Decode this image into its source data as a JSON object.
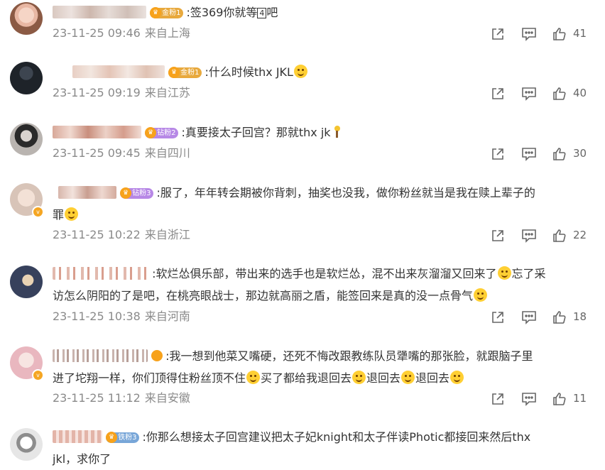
{
  "comments": [
    {
      "username": "Tichelapastles",
      "fan_badge": "金粉1",
      "text": ":签369你就等",
      "boxed": "4",
      "tail": "吧",
      "time": "23-11-25 09:46",
      "location": "来自上海",
      "likes": "41"
    },
    {
      "username": "定会有好事发生",
      "fan_badge": "金粉1",
      "text": ":什么时候thx JKL",
      "time": "23-11-25 09:19",
      "location": "来自江苏",
      "likes": "40"
    },
    {
      "username": "有人都不知成子",
      "fan_badge": "钻粉2",
      "text": ":真要接太子回宫？那就thx jk",
      "time": "23-11-25 09:45",
      "location": "来自四川",
      "likes": "30"
    },
    {
      "username": "于阿林好",
      "fan_badge": "钻粉3",
      "text_line1": ":服了，年年转会期被你背刺，抽奖也没我，做你粉丝就当是我在赎上辈子的",
      "text_line2": "罪",
      "time": "23-11-25 10:22",
      "location": "来自浙江",
      "likes": "22"
    },
    {
      "username": "",
      "text_line1": ":软烂怂俱乐部，带出来的选手也是软烂怂，混不出来灰溜溜又回来了",
      "text_line1b": "忘了采",
      "text_line2": "访怎么阴阳的了是吧，在桃亮眼战士，那边就高丽之盾，能签回来是真的没一点骨气",
      "time": "23-11-25 10:38",
      "location": "来自河南",
      "likes": "18"
    },
    {
      "username": "",
      "text_line1": ":我一想到他菜又嘴硬，还死不悔改跟教练队员犟嘴的那张脸，就跟脑子里",
      "text_line2a": "进了坨翔一样，你们顶得住粉丝顶不住",
      "text_line2b": "买了都给我退回去",
      "text_line2c": "退回去",
      "text_line2d": "退回去",
      "time": "23-11-25 11:12",
      "location": "来自安徽",
      "likes": "11"
    },
    {
      "username": "",
      "fan_badge": "铁粉3",
      "text_line1": ":你那么想接太子回宫建议把太子妃knight和太子伴读Photic都接回来然后thx",
      "text_line2": "jkl，求你了"
    }
  ],
  "icons": {
    "share": "share-icon",
    "comment": "comment-icon",
    "like": "like-icon"
  },
  "colors": {
    "meta": "#8a8a8a",
    "text": "#333333",
    "gold_badge": "#e8a93d",
    "diamond_badge": "#b788e6",
    "iron_badge": "#78a6d8"
  }
}
